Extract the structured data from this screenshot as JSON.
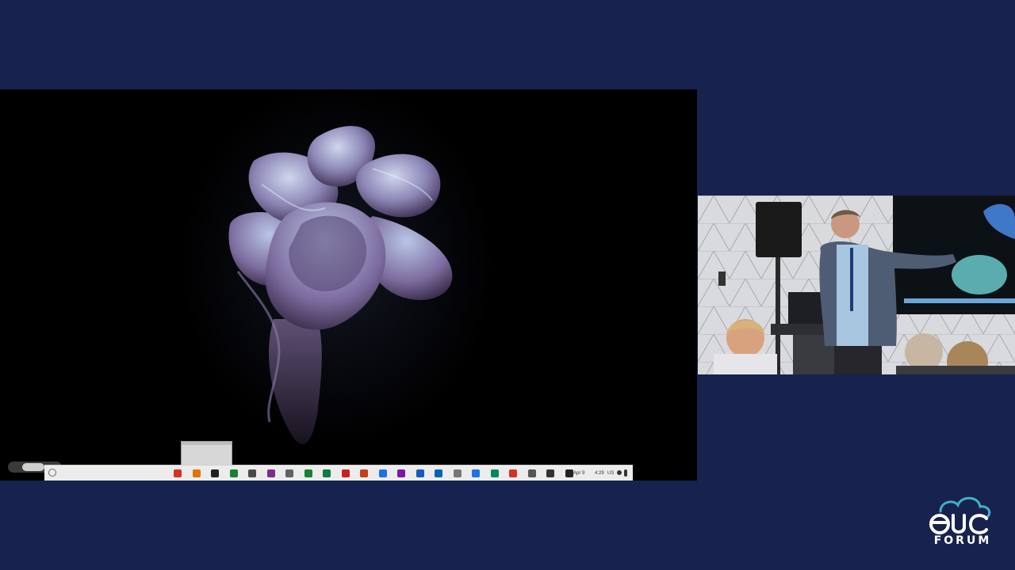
{
  "presentation": {
    "screen_share": {
      "wallpaper": "abstract-fabric-flower",
      "taskbar": {
        "date": "Apr 9",
        "time": "4:29",
        "locale": "US",
        "pinned_apps": [
          {
            "name": "chrome-icon",
            "color": "#d93025"
          },
          {
            "name": "files-icon",
            "color": "#e37400"
          },
          {
            "name": "terminal-icon",
            "color": "#202124"
          },
          {
            "name": "photos-icon",
            "color": "#188038"
          },
          {
            "name": "docs-icon",
            "color": "#4a4a4a"
          },
          {
            "name": "app-icon",
            "color": "#7a2d8f"
          },
          {
            "name": "notes-icon",
            "color": "#5f6368"
          },
          {
            "name": "sheets-icon",
            "color": "#188038"
          },
          {
            "name": "excel-icon",
            "color": "#107c41"
          },
          {
            "name": "gmail-icon",
            "color": "#c5221f"
          },
          {
            "name": "powerpoint-icon",
            "color": "#c43e1c"
          },
          {
            "name": "vscode-icon",
            "color": "#1a73e8"
          },
          {
            "name": "onenote-icon",
            "color": "#7719aa"
          },
          {
            "name": "word-icon",
            "color": "#185abd"
          },
          {
            "name": "outlook-icon",
            "color": "#0364b8"
          },
          {
            "name": "gallery-icon",
            "color": "#777777"
          },
          {
            "name": "zoom-icon",
            "color": "#1a73e8"
          },
          {
            "name": "play-store-icon",
            "color": "#01875f"
          },
          {
            "name": "record-icon",
            "color": "#d93025"
          },
          {
            "name": "settings-icon",
            "color": "#555555"
          },
          {
            "name": "pen-icon",
            "color": "#333333"
          },
          {
            "name": "account-icon",
            "color": "#222222"
          }
        ]
      }
    },
    "camera_feed": {
      "scene": "speaker-at-podium"
    },
    "brand": {
      "logo_text": "euc",
      "logo_subtext": "FORUM",
      "background_color": "#17224e",
      "logo_color": "#ffffff",
      "cloud_color": "#3fb1c9"
    }
  }
}
